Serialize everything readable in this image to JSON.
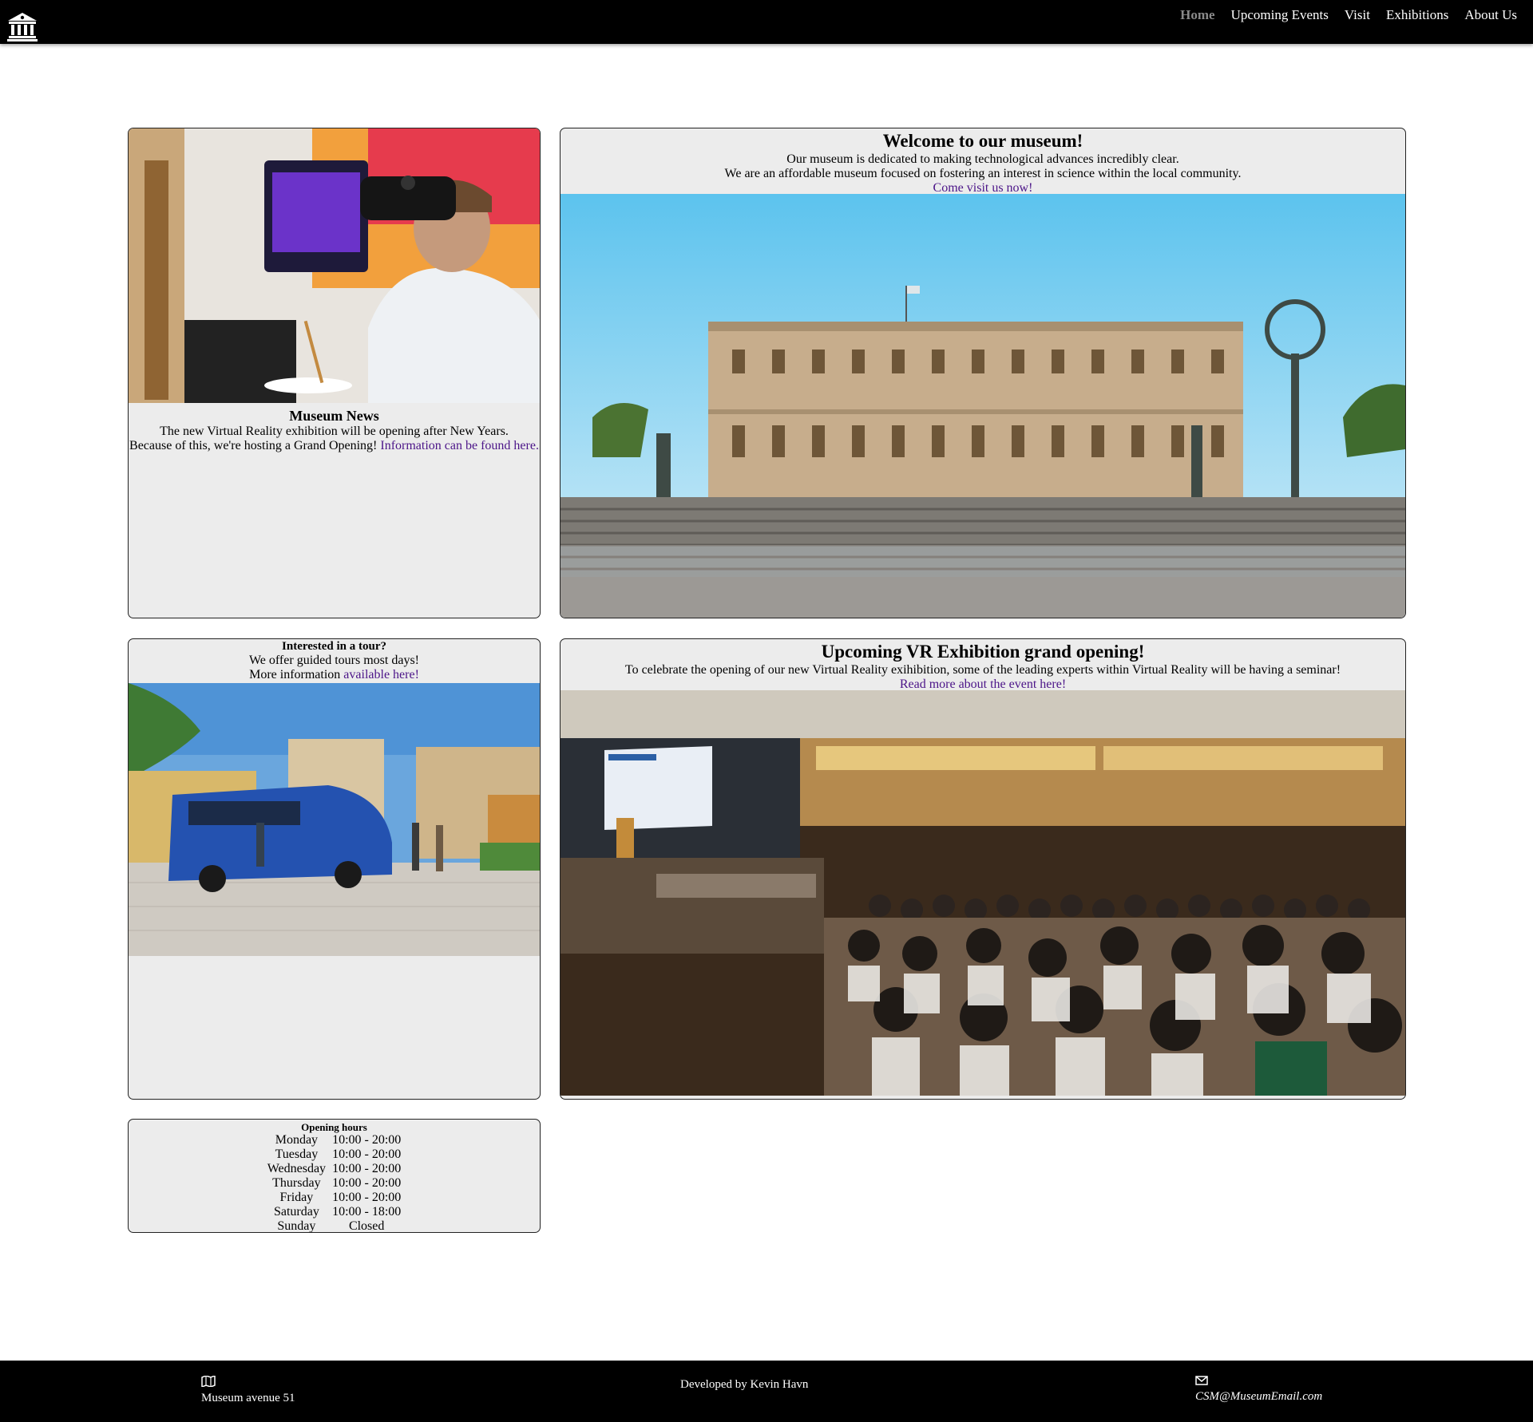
{
  "nav": {
    "logo_icon": "museum-building-icon",
    "links": [
      {
        "label": "Home",
        "active": true
      },
      {
        "label": "Upcoming Events",
        "active": false
      },
      {
        "label": "Visit",
        "active": false
      },
      {
        "label": "Exhibitions",
        "active": false
      },
      {
        "label": "About Us",
        "active": false
      }
    ]
  },
  "news": {
    "image": "vr-headset-painter-photo",
    "title": "Museum News",
    "line1": "The new Virtual Reality exhibition will be opening after New Years.",
    "line2": "Because of this, we're hosting a Grand Opening!",
    "link": "Information can be found here."
  },
  "welcome": {
    "title": "Welcome to our museum!",
    "line1": "Our museum is dedicated to making technological advances incredibly clear.",
    "line2": "We are an affordable museum focused on fostering an interest in science within the local community.",
    "link": "Come visit us now!",
    "image": "museum-building-photo"
  },
  "tour": {
    "title": "Interested in a tour?",
    "line1": "We offer guided tours most days!",
    "line2_prefix": "More information",
    "link": "available here!",
    "image": "tour-bus-photo"
  },
  "vr_event": {
    "title": "Upcoming VR Exhibition grand opening!",
    "line1": "To celebrate the opening of our new Virtual Reality exihibition, some of the leading experts within Virtual Reality will be having a seminar!",
    "link": "Read more about the event here!",
    "image": "seminar-audience-photo"
  },
  "hours": {
    "title": "Opening hours",
    "rows": [
      {
        "day": "Monday",
        "time": "10:00 - 20:00"
      },
      {
        "day": "Tuesday",
        "time": "10:00 - 20:00"
      },
      {
        "day": "Wednesday",
        "time": "10:00 - 20:00"
      },
      {
        "day": "Thursday",
        "time": "10:00 - 20:00"
      },
      {
        "day": "Friday",
        "time": "10:00 - 20:00"
      },
      {
        "day": "Saturday",
        "time": "10:00 - 18:00"
      },
      {
        "day": "Sunday",
        "time": "Closed"
      }
    ]
  },
  "footer": {
    "address_icon": "map-icon",
    "address": "Museum avenue 51",
    "developer": "Developed by Kevin Havn",
    "email_icon": "envelope-icon",
    "email": "CSM@MuseumEmail.com"
  },
  "colors": {
    "navbar": "#000000",
    "card_bg": "#ececec",
    "link": "#4b1488",
    "nav_active": "#8a8a8a"
  }
}
